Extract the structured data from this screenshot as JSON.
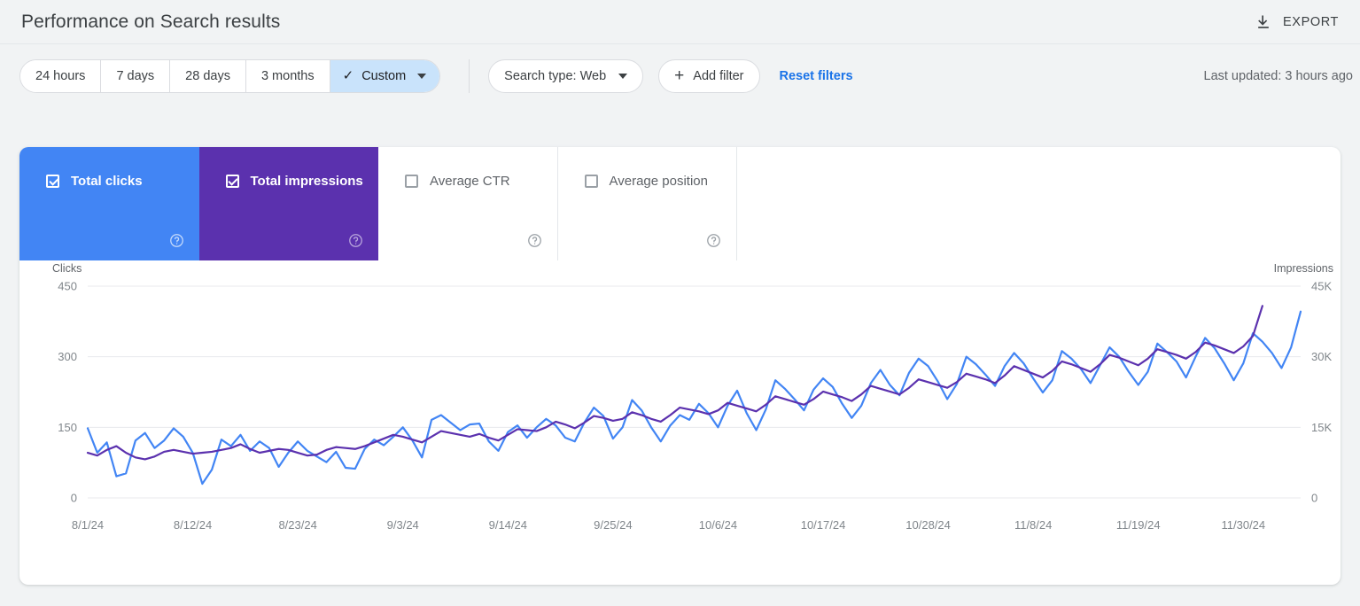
{
  "header": {
    "title": "Performance on Search results",
    "export_label": "EXPORT",
    "export_icon": "download-icon"
  },
  "toolbar": {
    "date_ranges": [
      {
        "label": "24 hours",
        "selected": false
      },
      {
        "label": "7 days",
        "selected": false
      },
      {
        "label": "28 days",
        "selected": false
      },
      {
        "label": "3 months",
        "selected": false
      },
      {
        "label": "Custom",
        "selected": true
      }
    ],
    "search_type_label": "Search type: Web",
    "add_filter_label": "Add filter",
    "add_filter_icon": "plus-icon",
    "reset_filters_label": "Reset filters",
    "last_updated": "Last updated: 3 hours ago"
  },
  "metrics": [
    {
      "label": "Total clicks",
      "checked": true,
      "color": "#4285f4",
      "help_icon": "help-circle-icon"
    },
    {
      "label": "Total impressions",
      "checked": true,
      "color": "#5b31ae",
      "help_icon": "help-circle-icon"
    },
    {
      "label": "Average CTR",
      "checked": false,
      "color": "#ffffff",
      "help_icon": "help-circle-icon"
    },
    {
      "label": "Average position",
      "checked": false,
      "color": "#ffffff",
      "help_icon": "help-circle-icon"
    }
  ],
  "chart_data": {
    "type": "line",
    "title": "",
    "xlabel": "",
    "grid": true,
    "legend_position": "none",
    "x_tick_labels": [
      "8/1/24",
      "8/12/24",
      "8/23/24",
      "9/3/24",
      "9/14/24",
      "9/25/24",
      "10/6/24",
      "10/17/24",
      "10/28/24",
      "11/8/24",
      "11/19/24",
      "11/30/24"
    ],
    "x_tick_indices": [
      0,
      11,
      22,
      33,
      44,
      55,
      66,
      77,
      88,
      99,
      110,
      121
    ],
    "x_start": "8/1/24",
    "x_end": "11/30/24",
    "axes": [
      {
        "name": "Clicks",
        "side": "left",
        "ylim": [
          0,
          450
        ],
        "ticks": [
          0,
          150,
          300,
          450
        ],
        "tick_labels": [
          "0",
          "150",
          "300",
          "450"
        ],
        "color": "#4285f4"
      },
      {
        "name": "Impressions",
        "side": "right",
        "ylim": [
          0,
          45000
        ],
        "ticks": [
          0,
          15000,
          30000,
          45000
        ],
        "tick_labels": [
          "0",
          "15K",
          "30K",
          "45K"
        ],
        "color": "#5b31ae"
      }
    ],
    "series": [
      {
        "name": "Total clicks",
        "axis": "Clicks",
        "color": "#4285f4",
        "values": [
          148,
          96,
          118,
          46,
          52,
          122,
          138,
          106,
          122,
          148,
          130,
          96,
          30,
          60,
          124,
          110,
          134,
          100,
          120,
          106,
          66,
          96,
          120,
          100,
          88,
          76,
          98,
          64,
          62,
          104,
          124,
          112,
          130,
          150,
          122,
          86,
          166,
          176,
          160,
          144,
          156,
          158,
          120,
          100,
          140,
          154,
          128,
          150,
          168,
          154,
          128,
          120,
          160,
          192,
          174,
          126,
          150,
          208,
          186,
          150,
          120,
          154,
          176,
          166,
          200,
          180,
          150,
          196,
          228,
          180,
          144,
          188,
          250,
          232,
          210,
          186,
          230,
          254,
          236,
          200,
          170,
          196,
          244,
          272,
          240,
          218,
          266,
          296,
          280,
          248,
          210,
          242,
          300,
          284,
          262,
          238,
          280,
          308,
          286,
          254,
          224,
          250,
          312,
          296,
          274,
          244,
          282,
          320,
          300,
          268,
          240,
          268,
          328,
          310,
          290,
          256,
          300,
          340,
          318,
          286,
          250,
          286,
          350,
          332,
          308,
          276,
          320,
          396
        ]
      },
      {
        "name": "Total impressions",
        "axis": "Impressions",
        "color": "#5b31ae",
        "values": [
          9600,
          9000,
          10200,
          11000,
          9600,
          8600,
          8200,
          8800,
          9800,
          10200,
          9800,
          9400,
          9600,
          9800,
          10200,
          10600,
          11400,
          10400,
          9600,
          10000,
          10400,
          10200,
          9600,
          9000,
          9200,
          10200,
          10800,
          10600,
          10400,
          11000,
          11800,
          12600,
          13400,
          13000,
          12400,
          11800,
          13000,
          14200,
          13800,
          13400,
          13000,
          13600,
          12800,
          12200,
          13400,
          14600,
          14400,
          14200,
          15000,
          16200,
          15600,
          14800,
          16000,
          17400,
          17000,
          16400,
          16800,
          18200,
          17600,
          16800,
          16200,
          17600,
          19200,
          18800,
          18400,
          17800,
          18600,
          20200,
          19600,
          19000,
          18400,
          19800,
          21600,
          21000,
          20400,
          19800,
          21000,
          22600,
          22000,
          21400,
          20600,
          22000,
          23800,
          23200,
          22600,
          22000,
          23400,
          25200,
          24600,
          24000,
          23400,
          24600,
          26400,
          25800,
          25200,
          24400,
          26000,
          28000,
          27200,
          26400,
          25600,
          27000,
          29000,
          28400,
          27600,
          26800,
          28400,
          30400,
          29800,
          29000,
          28200,
          29600,
          31600,
          31000,
          30400,
          29600,
          31000,
          33000,
          32400,
          31600,
          30800,
          32200,
          34400,
          40800
        ]
      }
    ]
  }
}
